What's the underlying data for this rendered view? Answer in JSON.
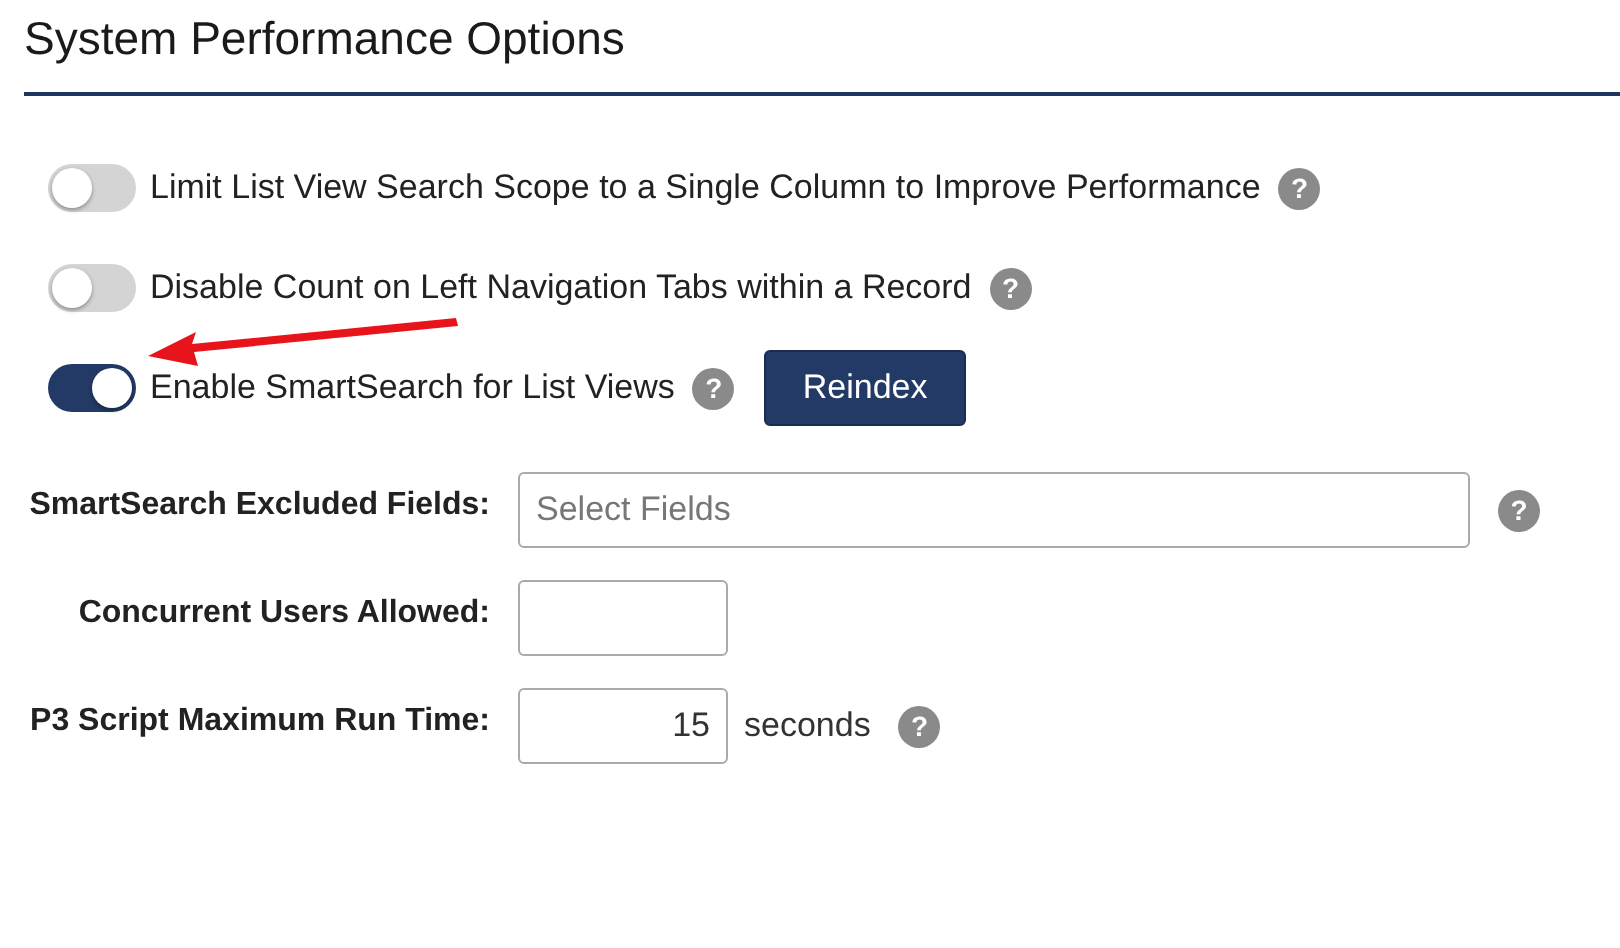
{
  "title": "System Performance Options",
  "toggles": [
    {
      "label": "Limit List View Search Scope to a Single Column to Improve Performance",
      "on": false,
      "help": "?"
    },
    {
      "label": "Disable Count on Left Navigation Tabs within a Record",
      "on": false,
      "help": "?"
    },
    {
      "label": "Enable SmartSearch for List Views",
      "on": true,
      "help": "?",
      "button": "Reindex"
    }
  ],
  "fields": [
    {
      "label": "SmartSearch Excluded Fields:",
      "kind": "wide",
      "placeholder": "Select Fields",
      "help": "?"
    },
    {
      "label": "Concurrent Users Allowed:",
      "kind": "short"
    },
    {
      "label": "P3 Script Maximum Run Time:",
      "kind": "short",
      "value": "15",
      "unit": "seconds",
      "help": "?"
    }
  ]
}
